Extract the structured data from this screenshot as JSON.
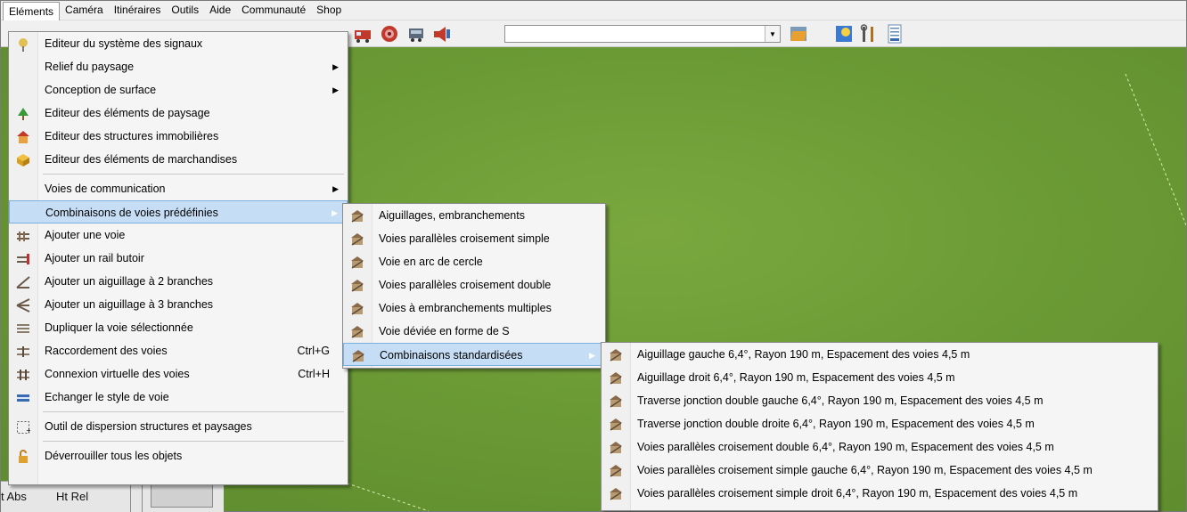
{
  "menubar": [
    "Eléments",
    "Caméra",
    "Itinéraires",
    "Outils",
    "Aide",
    "Communauté",
    "Shop"
  ],
  "main_menu": {
    "items": [
      {
        "label": "Editeur du système des signaux",
        "icon": "signal-editor-icon"
      },
      {
        "label": "Relief du paysage",
        "submenu": true
      },
      {
        "label": "Conception de surface",
        "submenu": true
      },
      {
        "label": "Editeur des éléments de paysage",
        "icon": "landscape-editor-icon"
      },
      {
        "label": "Editeur des structures immobilières",
        "icon": "building-editor-icon"
      },
      {
        "label": "Editeur des éléments de marchandises",
        "icon": "goods-editor-icon"
      },
      {
        "separator": true
      },
      {
        "label": "Voies de communication",
        "submenu": true
      },
      {
        "label": "Combinaisons de voies prédéfinies",
        "submenu": true,
        "highlighted": true
      },
      {
        "label": "Ajouter une voie",
        "icon": "add-track-icon"
      },
      {
        "label": "Ajouter un rail butoir",
        "icon": "buffer-stop-icon"
      },
      {
        "label": "Ajouter un aiguillage à 2 branches",
        "icon": "switch-2-icon"
      },
      {
        "label": "Ajouter un aiguillage à 3 branches",
        "icon": "switch-3-icon"
      },
      {
        "label": "Dupliquer la voie sélectionnée",
        "icon": "duplicate-track-icon"
      },
      {
        "label": "Raccordement des voies",
        "icon": "connect-tracks-icon",
        "shortcut": "Ctrl+G"
      },
      {
        "label": "Connexion virtuelle des voies",
        "icon": "virtual-connect-icon",
        "shortcut": "Ctrl+H"
      },
      {
        "label": "Echanger le style de voie",
        "icon": "track-style-icon"
      },
      {
        "separator": true
      },
      {
        "label": "Outil de dispersion structures et paysages",
        "icon": "scatter-tool-icon"
      },
      {
        "separator": true
      },
      {
        "label": "Déverrouiller tous les objets",
        "icon": "unlock-icon"
      }
    ]
  },
  "sub_menu_1": {
    "items": [
      {
        "label": "Aiguillages, embranchements"
      },
      {
        "label": "Voies parallèles croisement simple"
      },
      {
        "label": "Voie en arc de cercle"
      },
      {
        "label": "Voies parallèles croisement double"
      },
      {
        "label": "Voies à embranchements multiples"
      },
      {
        "label": "Voie déviée en forme de S"
      },
      {
        "label": "Combinaisons standardisées",
        "submenu": true,
        "highlighted": true
      }
    ]
  },
  "sub_menu_2": {
    "items": [
      {
        "label": "Aiguillage gauche 6,4°, Rayon 190 m, Espacement des voies 4,5 m"
      },
      {
        "label": "Aiguillage droit 6,4°, Rayon 190 m, Espacement des voies 4,5 m"
      },
      {
        "label": "Traverse jonction double gauche 6,4°, Rayon 190 m, Espacement des voies 4,5 m"
      },
      {
        "label": "Traverse jonction double droite 6,4°, Rayon 190 m, Espacement des voies 4,5 m"
      },
      {
        "label": "Voies parallèles croisement double 6,4°, Rayon 190 m, Espacement des voies 4,5 m"
      },
      {
        "label": "Voies parallèles croisement simple gauche 6,4°, Rayon 190 m, Espacement des voies 4,5 m"
      },
      {
        "label": "Voies parallèles croisement simple droit 6,4°, Rayon 190 m, Espacement des voies 4,5 m"
      }
    ]
  },
  "status": {
    "ht_abs": "t Abs",
    "ht_rel": "Ht Rel"
  },
  "colors": {
    "highlight": "#c6def5",
    "terrain": "#6b9a35",
    "menu_bg": "#f5f5f5"
  }
}
